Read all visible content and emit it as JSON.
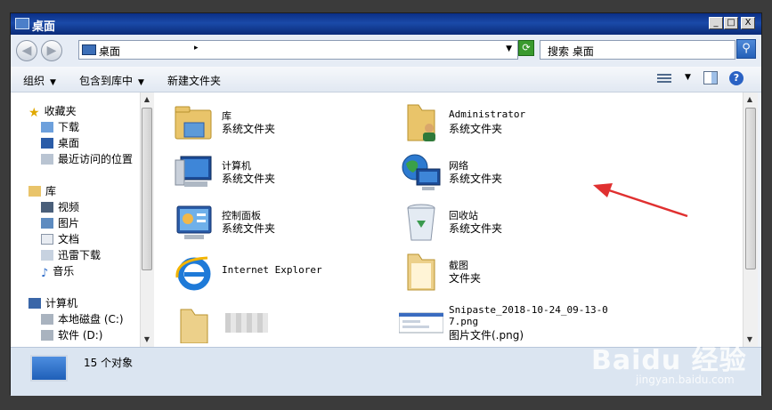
{
  "window": {
    "title": "桌面"
  },
  "caption_buttons": {
    "minimize": "_",
    "maximize": "□",
    "close": "X"
  },
  "address": {
    "current": "桌面",
    "search_placeholder": "搜索 桌面"
  },
  "toolbar": {
    "organize": "组织",
    "include_in_library": "包含到库中",
    "new_folder": "新建文件夹"
  },
  "nav": {
    "favorites": {
      "label": "收藏夹",
      "items": [
        "下载",
        "桌面",
        "最近访问的位置"
      ]
    },
    "libraries": {
      "label": "库",
      "items": [
        "视频",
        "图片",
        "文档",
        "迅雷下载",
        "音乐"
      ]
    },
    "computer": {
      "label": "计算机",
      "items": [
        "本地磁盘 (C:)",
        "软件 (D:)"
      ]
    }
  },
  "items": [
    {
      "name": "库",
      "type": "系统文件夹",
      "icon": "library-icon"
    },
    {
      "name": "Administrator",
      "type": "系统文件夹",
      "icon": "user-folder-icon"
    },
    {
      "name": "计算机",
      "type": "系统文件夹",
      "icon": "computer-icon"
    },
    {
      "name": "网络",
      "type": "系统文件夹",
      "icon": "network-icon"
    },
    {
      "name": "控制面板",
      "type": "系统文件夹",
      "icon": "control-panel-icon"
    },
    {
      "name": "回收站",
      "type": "系统文件夹",
      "icon": "recycle-bin-icon"
    },
    {
      "name": "Internet Explorer",
      "type": "",
      "icon": "internet-explorer-icon"
    },
    {
      "name": "截图",
      "type": "文件夹",
      "icon": "folder-icon"
    },
    {
      "name": "",
      "type": "",
      "icon": "folder-icon"
    },
    {
      "name": "Snipaste_2018-10-24_09-13-07.png",
      "type": "图片文件(.png)",
      "icon": "image-thumbnail-icon"
    }
  ],
  "status": {
    "count": "15 个对象"
  },
  "watermark": {
    "main": "Baidu 经验",
    "sub": "jingyan.baidu.com"
  },
  "colors": {
    "titlebar": "#1a4aa8",
    "annotation_arrow": "#e03030"
  }
}
